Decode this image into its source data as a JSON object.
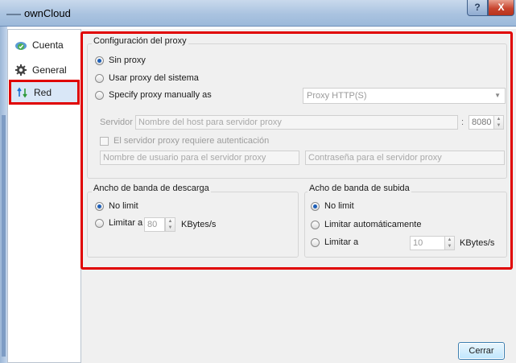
{
  "window": {
    "title": "ownCloud",
    "help_glyph": "?",
    "close_glyph": "X"
  },
  "sidebar": {
    "items": [
      {
        "label": "Cuenta",
        "icon": "owncloud-account-icon"
      },
      {
        "label": "General",
        "icon": "gear-icon"
      },
      {
        "label": "Red",
        "icon": "network-arrows-icon",
        "selected": true
      }
    ]
  },
  "proxy": {
    "title": "Configuración del proxy",
    "options": [
      {
        "label": "Sin proxy",
        "checked": true
      },
      {
        "label": "Usar proxy del sistema",
        "checked": false
      },
      {
        "label": "Specify proxy manually as",
        "checked": false
      }
    ],
    "type_select": "Proxy HTTP(S)",
    "server_label": "Servidor",
    "server_placeholder": "Nombre del host para servidor proxy",
    "colon": ":",
    "port_value": "8080",
    "auth_label": "El servidor proxy requiere autenticación",
    "user_placeholder": "Nombre de usuario para el servidor proxy",
    "password_placeholder": "Contraseña para el servidor proxy"
  },
  "download": {
    "title": "Ancho de banda de descarga",
    "no_limit": "No limit",
    "limit_to": "Limitar a",
    "value": "80",
    "unit": "KBytes/s"
  },
  "upload": {
    "title": "Acho de banda de subida",
    "no_limit": "No limit",
    "auto": "Limitar automáticamente",
    "limit_to": "Limitar a",
    "value": "10",
    "unit": "KBytes/s"
  },
  "footer": {
    "close_label": "Cerrar"
  },
  "colors": {
    "highlight": "#e00000",
    "accent": "#1d5fb8"
  }
}
